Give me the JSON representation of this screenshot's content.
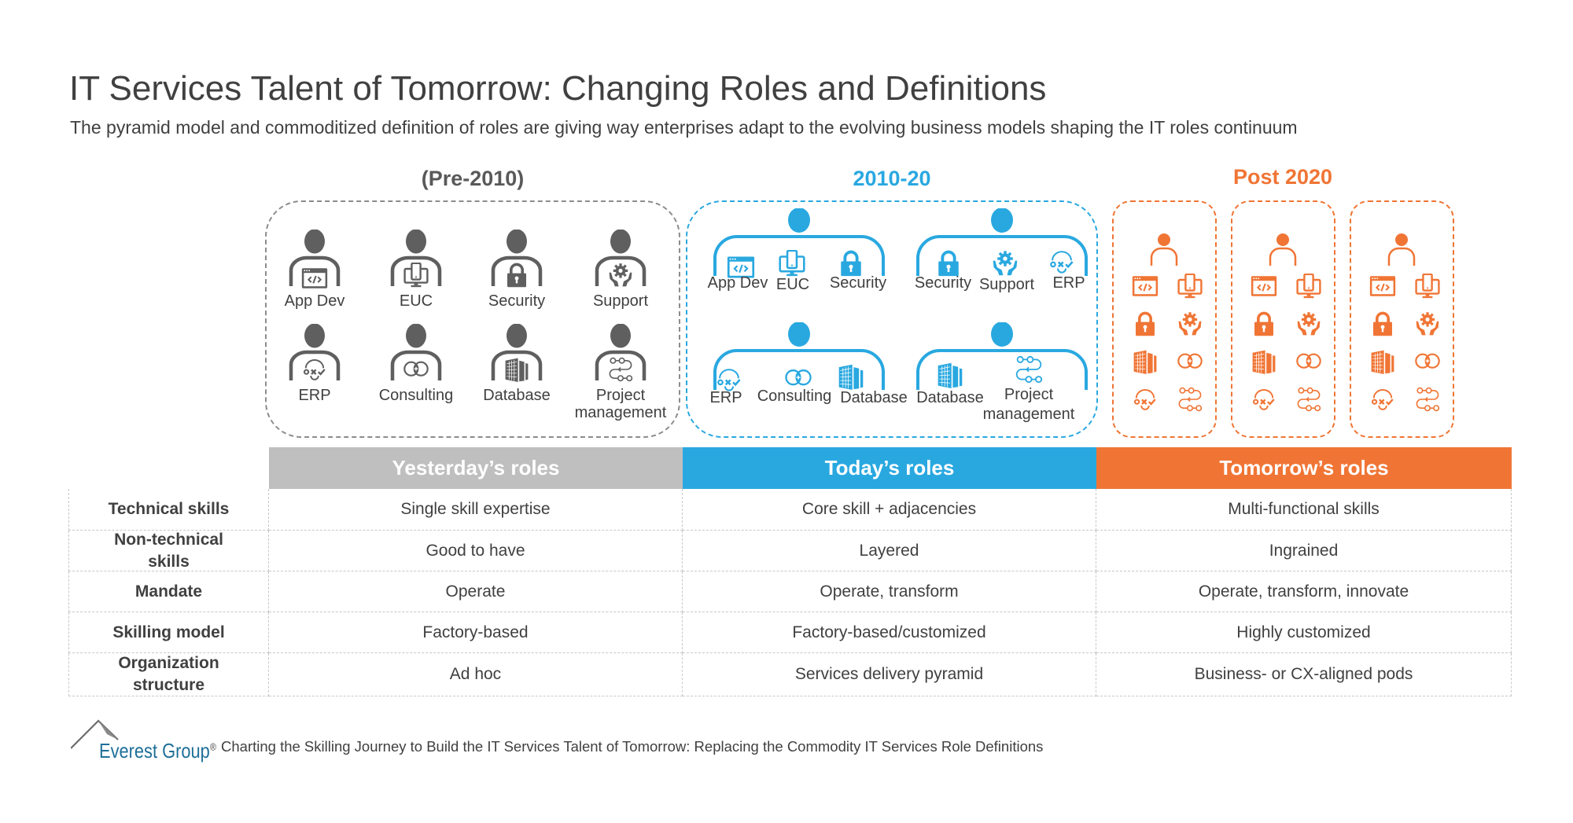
{
  "header": {
    "title": "IT Services Talent of Tomorrow: Changing Roles and Definitions",
    "subtitle": "The pyramid model and commoditized definition of roles are giving way enterprises adapt to the evolving business models shaping the IT roles continuum"
  },
  "colors": {
    "text": "#404040",
    "yesterday": "#5f5f5f",
    "yesterday_header": "#bfbfbf",
    "today": "#29a8e0",
    "tomorrow": "#f07535",
    "brand": "#1f6f99"
  },
  "eras": {
    "pre2010": {
      "label": "(Pre-2010)",
      "roles": [
        {
          "label": "App Dev",
          "icon": "code-window-icon"
        },
        {
          "label": "EUC",
          "icon": "device-monitor-icon"
        },
        {
          "label": "Security",
          "icon": "padlock-icon"
        },
        {
          "label": "Support",
          "icon": "gear-hands-icon"
        },
        {
          "label": "ERP",
          "icon": "erp-cycle-icon"
        },
        {
          "label": "Consulting",
          "icon": "consulting-icon"
        },
        {
          "label": "Database",
          "icon": "database-building-icon"
        },
        {
          "label": "Project\nmanagement",
          "icon": "workflow-icon"
        }
      ]
    },
    "y2010_20": {
      "label": "2010-20",
      "groups": [
        {
          "skills": [
            {
              "label": "App Dev",
              "icon": "code-window-icon"
            },
            {
              "label": "EUC",
              "icon": "device-monitor-icon"
            },
            {
              "label": "Security",
              "icon": "padlock-icon"
            }
          ]
        },
        {
          "skills": [
            {
              "label": "Security",
              "icon": "padlock-icon"
            },
            {
              "label": "Support",
              "icon": "gear-hands-icon"
            },
            {
              "label": "ERP",
              "icon": "erp-cycle-icon"
            }
          ]
        },
        {
          "skills": [
            {
              "label": "ERP",
              "icon": "erp-cycle-icon"
            },
            {
              "label": "Consulting",
              "icon": "consulting-icon"
            },
            {
              "label": "Database",
              "icon": "database-building-icon"
            }
          ]
        },
        {
          "skills": [
            {
              "label": "Database",
              "icon": "database-building-icon"
            },
            {
              "label": "Project management",
              "icon": "workflow-icon"
            }
          ]
        }
      ],
      "group_labels": {
        "g0": [
          "App Dev",
          "EUC",
          "Security"
        ],
        "g1": [
          "Security",
          "Support",
          "ERP"
        ],
        "g2": [
          "ERP",
          "Consulting",
          "Database"
        ],
        "g3_a": "Database",
        "g3_b1": "Project",
        "g3_b2": "management"
      }
    },
    "post2020": {
      "label": "Post 2020",
      "pods": 3,
      "pod_icons": [
        "code-window-icon",
        "device-monitor-icon",
        "padlock-icon",
        "gear-hands-icon",
        "database-building-icon",
        "consulting-icon",
        "erp-cycle-icon",
        "workflow-icon"
      ]
    }
  },
  "table": {
    "columns": [
      "Yesterday’s roles",
      "Today’s roles",
      "Tomorrow’s roles"
    ],
    "rows": [
      {
        "label": "Technical skills",
        "values": [
          "Single skill expertise",
          "Core skill + adjacencies",
          "Multi-functional skills"
        ]
      },
      {
        "label": "Non-technical skills",
        "values": [
          "Good to have",
          "Layered",
          "Ingrained"
        ]
      },
      {
        "label": "Mandate",
        "values": [
          "Operate",
          "Operate, transform",
          "Operate, transform, innovate"
        ]
      },
      {
        "label": "Skilling model",
        "values": [
          "Factory-based",
          "Factory-based/customized",
          "Highly customized"
        ]
      },
      {
        "label": "Organization structure",
        "values": [
          "Ad hoc",
          "Services delivery pyramid",
          "Business- or CX-aligned pods"
        ]
      }
    ]
  },
  "footer": {
    "brand": "Everest Group",
    "registered": "®",
    "text": "Charting the Skilling Journey to Build the IT Services Talent of Tomorrow: Replacing the Commodity IT Services Role Definitions"
  }
}
